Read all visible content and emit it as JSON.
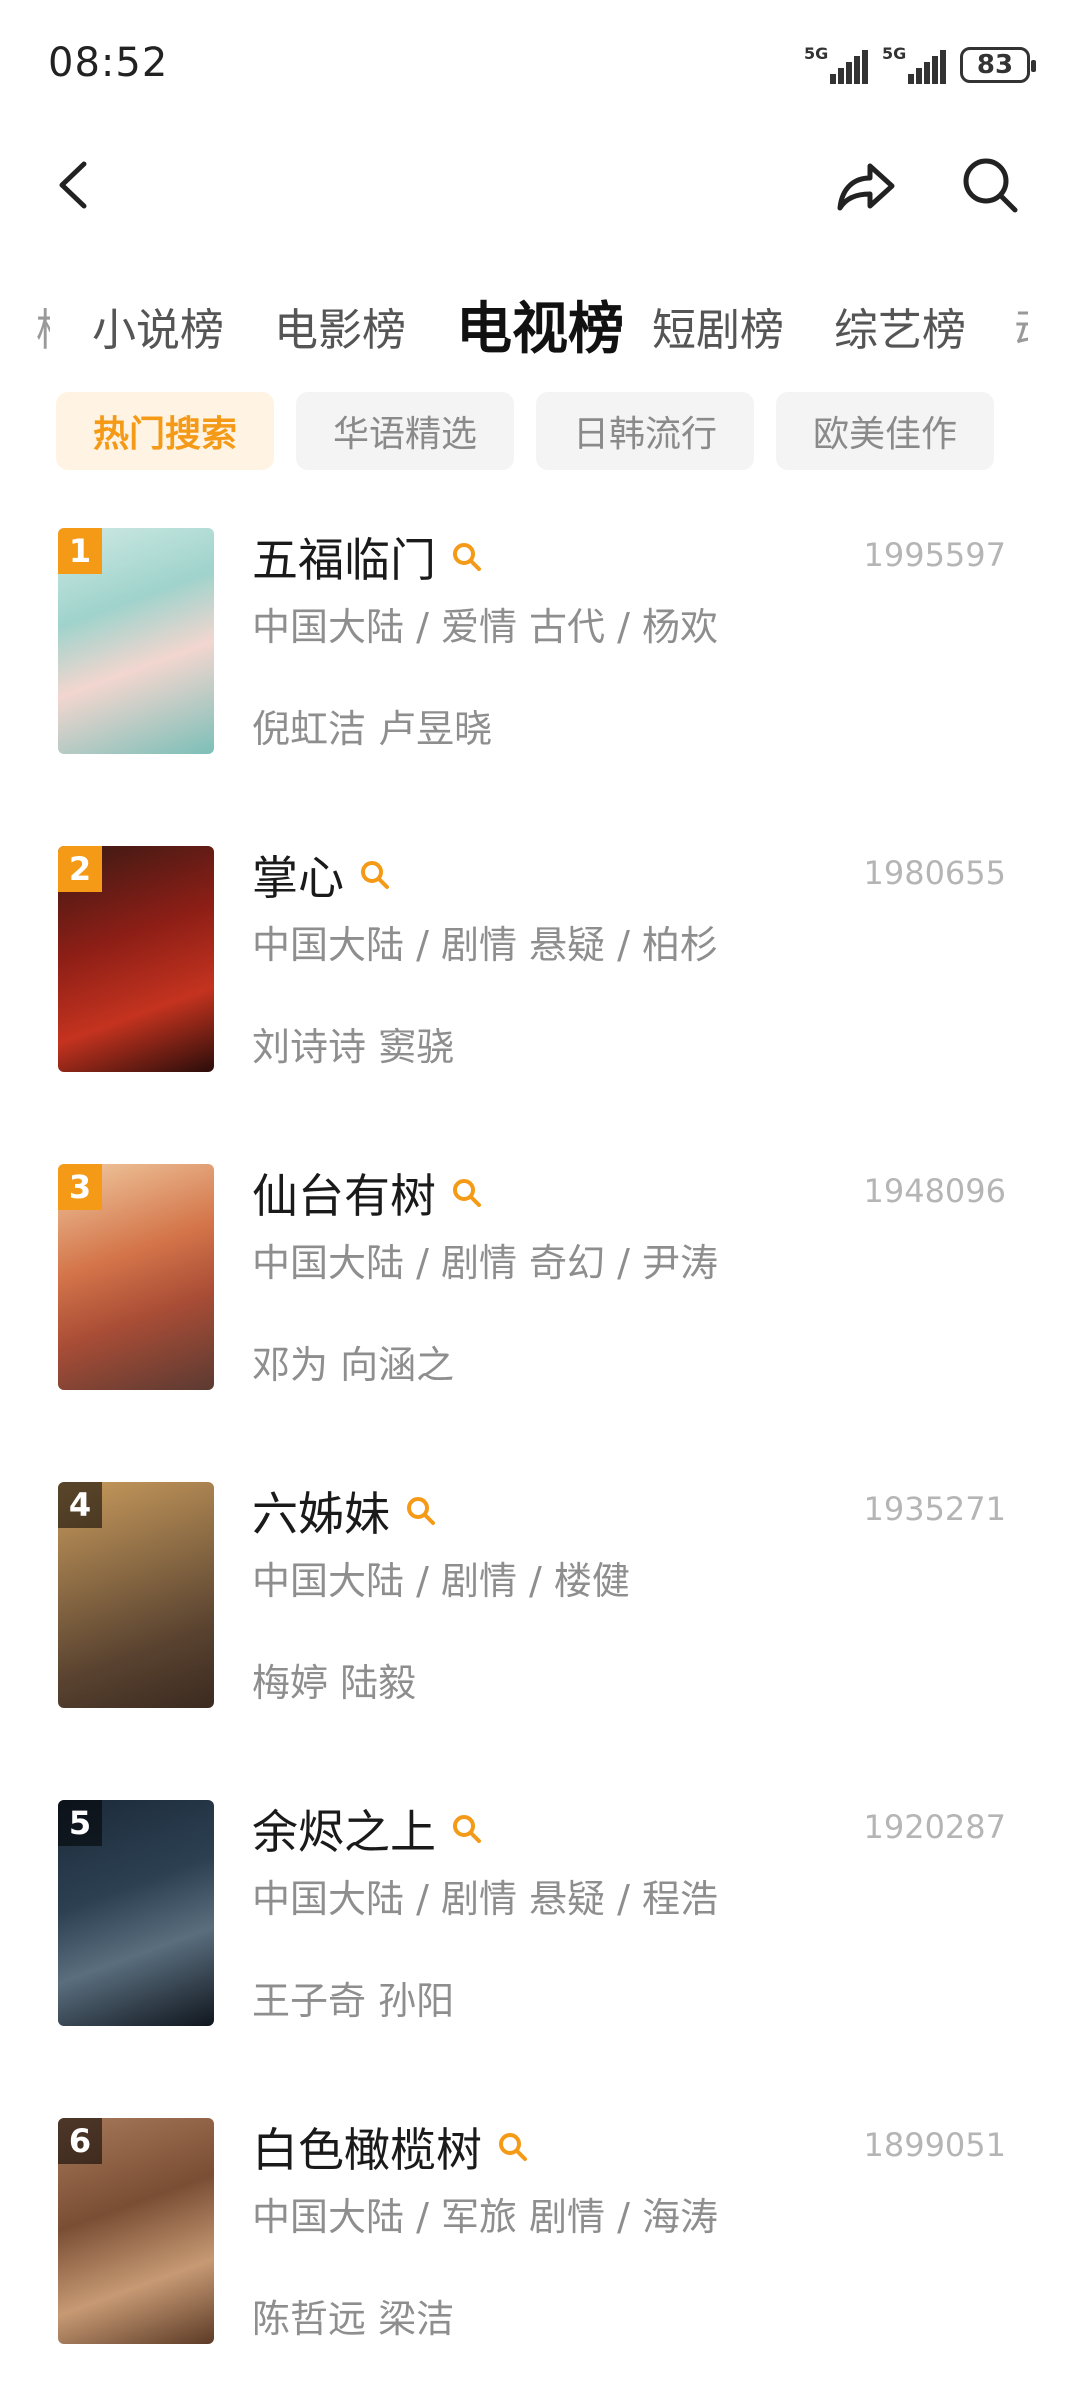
{
  "status_bar": {
    "time": "08:52",
    "network_1": "5G",
    "network_2": "5G",
    "battery": "83"
  },
  "nav": {
    "back_icon": "chevron-left-icon",
    "share_icon": "share-arrow-icon",
    "search_icon": "search-icon"
  },
  "tabs": [
    {
      "label": "小说榜",
      "active": false
    },
    {
      "label": "电影榜",
      "active": false
    },
    {
      "label": "电视榜",
      "active": true
    },
    {
      "label": "短剧榜",
      "active": false
    },
    {
      "label": "综艺榜",
      "active": false
    }
  ],
  "chips": [
    {
      "label": "热门搜索",
      "active": true
    },
    {
      "label": "华语精选",
      "active": false
    },
    {
      "label": "日韩流行",
      "active": false
    },
    {
      "label": "欧美佳作",
      "active": false
    }
  ],
  "colors": {
    "accent": "#f59a17",
    "chip_active_bg": "#fff4e4",
    "muted_text": "#8e8e8e",
    "score_text": "#b5b5b5"
  },
  "items": [
    {
      "rank": "1",
      "title": "五福临门",
      "score": "1995597",
      "meta": "中国大陆 / 爱情 古代 / 杨欢",
      "cast": "倪虹洁 卢昱晓"
    },
    {
      "rank": "2",
      "title": "掌心",
      "score": "1980655",
      "meta": "中国大陆 / 剧情 悬疑 / 柏杉",
      "cast": "刘诗诗 窦骁"
    },
    {
      "rank": "3",
      "title": "仙台有树",
      "score": "1948096",
      "meta": "中国大陆 / 剧情 奇幻 / 尹涛",
      "cast": "邓为 向涵之"
    },
    {
      "rank": "4",
      "title": "六姊妹",
      "score": "1935271",
      "meta": "中国大陆 / 剧情 / 楼健",
      "cast": "梅婷 陆毅"
    },
    {
      "rank": "5",
      "title": "余烬之上",
      "score": "1920287",
      "meta": "中国大陆 / 剧情 悬疑 / 程浩",
      "cast": "王子奇 孙阳"
    },
    {
      "rank": "6",
      "title": "白色橄榄树",
      "score": "1899051",
      "meta": "中国大陆 / 军旅 剧情 / 海涛",
      "cast": "陈哲远 梁洁"
    }
  ]
}
